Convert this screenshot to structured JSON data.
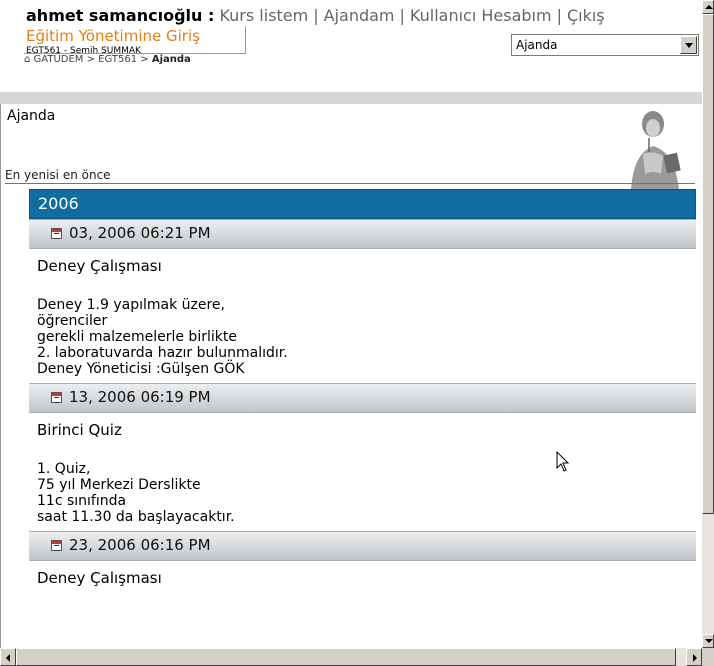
{
  "header": {
    "user_name": "ahmet samancıoğlu :",
    "nav": [
      "Kurs listem",
      "Ajandam",
      "Kullanıcı Hesabım",
      "Çıkış"
    ],
    "site_title": "Eğitim Yönetimine Giriş",
    "course_code": "EGT561 - Semih SUMMAK",
    "breadcrumb": {
      "root": "GATÜDEM",
      "sep1": " > ",
      "course": "EGT561",
      "sep2": " > ",
      "current": "Ajanda"
    },
    "select": {
      "value": "Ajanda"
    }
  },
  "main": {
    "heading": "Ajanda",
    "sort_label": "En yenisi en önce",
    "year": "2006",
    "events": [
      {
        "date": "03, 2006 06:21 PM",
        "title": "Deney Çalışması",
        "lines": [
          "Deney 1.9 yapılmak üzere,",
          "öğrenciler",
          "gerekli malzemelerle birlikte",
          "2. laboratuvarda hazır bulunmalıdır.",
          "Deney Yöneticisi :Gülşen GÖK"
        ]
      },
      {
        "date": "13, 2006 06:19 PM",
        "title": "Birinci Quiz",
        "lines": [
          "1. Quiz,",
          "75 yıl Merkezi Derslikte",
          "11c sınıfında",
          "saat 11.30 da başlayacaktır."
        ]
      },
      {
        "date": "23, 2006 06:16 PM",
        "title": "Deney Çalışması",
        "lines": []
      }
    ]
  },
  "colors": {
    "year_bar": "#0f6da2",
    "site_title": "#e67e10"
  }
}
